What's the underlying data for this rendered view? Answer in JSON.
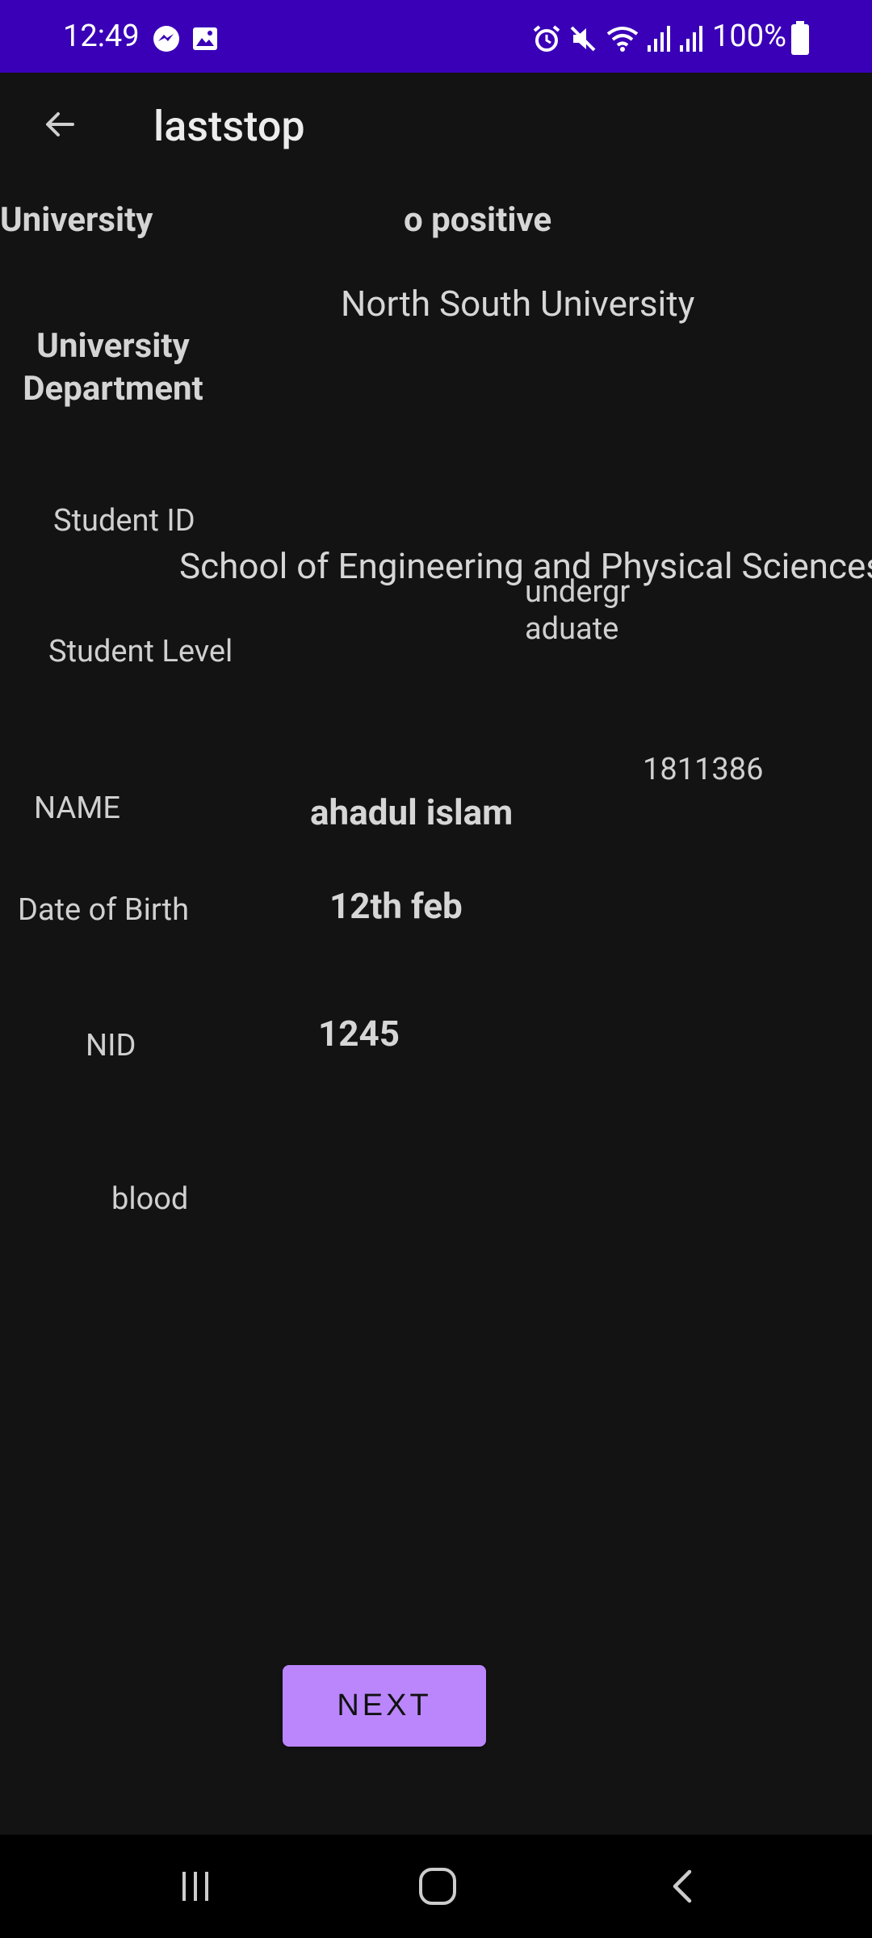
{
  "status_bar": {
    "time": "12:49",
    "battery": "100%",
    "background": "#3a00b7",
    "icons": [
      "messenger-icon",
      "gallery-icon",
      "alarm-icon",
      "mute-icon",
      "wifi-icon",
      "signal-icon",
      "signal-icon",
      "battery-icon"
    ]
  },
  "app_bar": {
    "title": "laststop"
  },
  "labels": {
    "university": "University",
    "university_department": "University Department",
    "student_id": "Student ID",
    "student_level": "Student Level",
    "name": "NAME",
    "date_of_birth": "Date of Birth",
    "nid": "NID",
    "blood": "blood"
  },
  "values": {
    "blood_group": "o positive",
    "university": "North South University",
    "department": "School of Engineering and Physical Sciences",
    "student_level": "undergraduate",
    "student_id": "1811386",
    "name": "ahadul islam",
    "date_of_birth": "12th feb",
    "nid": "1245"
  },
  "actions": {
    "next_label": "NEXT",
    "accent": "#bb86fc"
  },
  "nav": {
    "items": [
      "recent-apps",
      "home",
      "back"
    ]
  }
}
